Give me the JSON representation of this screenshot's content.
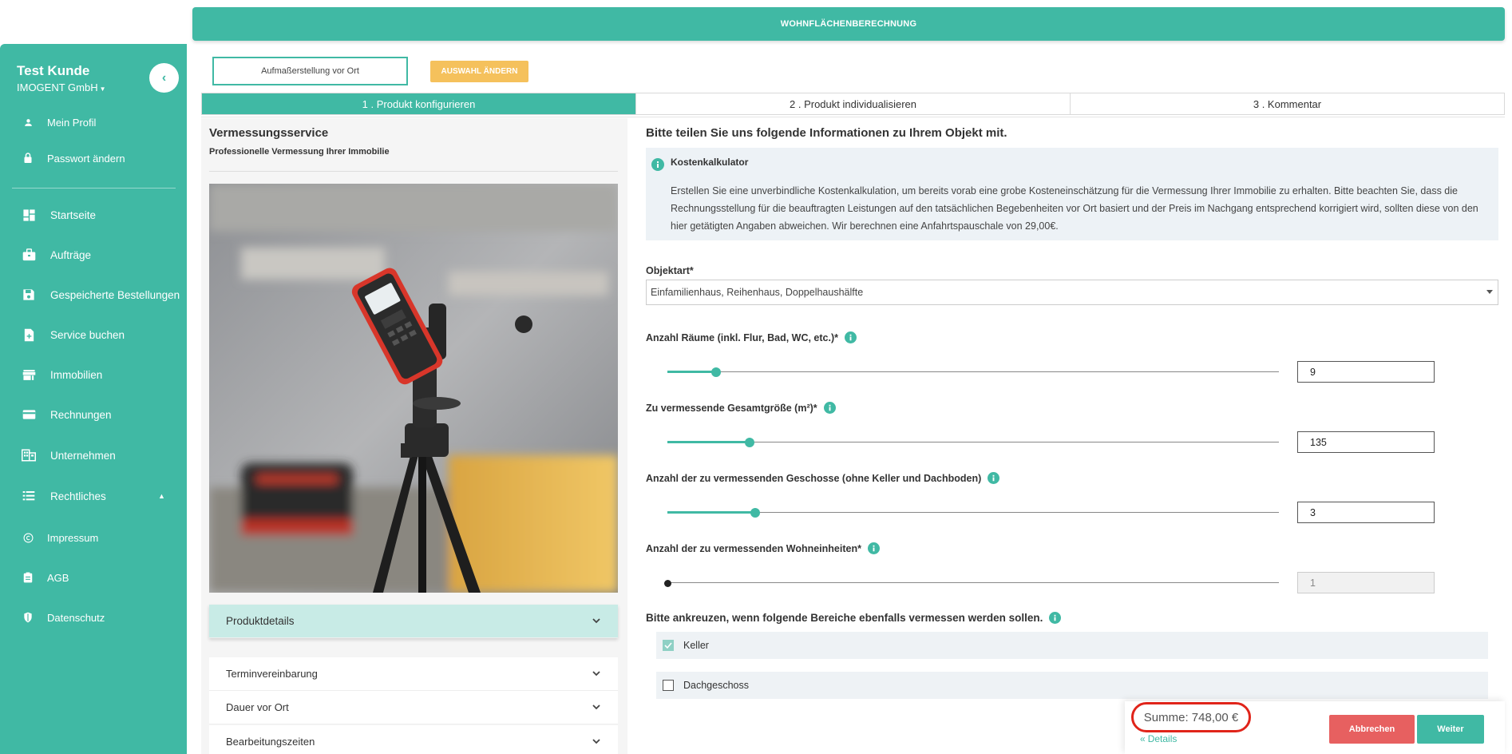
{
  "header": {
    "title": "WOHNFLÄCHENBERECHNUNG"
  },
  "sidebar": {
    "user_name": "Test Kunde",
    "company": "IMOGENT GmbH",
    "profile_items": [
      {
        "label": "Mein Profil",
        "icon": "person-icon"
      },
      {
        "label": "Passwort ändern",
        "icon": "lock-icon"
      }
    ],
    "nav_items": [
      {
        "label": "Startseite",
        "icon": "dashboard-icon"
      },
      {
        "label": "Aufträge",
        "icon": "briefcase-icon"
      },
      {
        "label": "Gespeicherte Bestellungen",
        "icon": "save-icon"
      },
      {
        "label": "Service buchen",
        "icon": "document-add-icon"
      },
      {
        "label": "Immobilien",
        "icon": "store-icon"
      },
      {
        "label": "Rechnungen",
        "icon": "credit-card-icon"
      },
      {
        "label": "Unternehmen",
        "icon": "company-icon"
      },
      {
        "label": "Rechtliches",
        "icon": "list-icon"
      }
    ],
    "legal_items": [
      {
        "label": "Impressum",
        "icon": "copyright-icon"
      },
      {
        "label": "AGB",
        "icon": "clipboard-icon"
      },
      {
        "label": "Datenschutz",
        "icon": "shield-icon"
      }
    ]
  },
  "toolbar": {
    "mode_label": "Aufmaßerstellung vor Ort",
    "change_label": "AUSWAHL ÄNDERN"
  },
  "steps": [
    {
      "label": "1 . Produkt konfigurieren",
      "active": true
    },
    {
      "label": "2 . Produkt individualisieren",
      "active": false
    },
    {
      "label": "3 . Kommentar",
      "active": false
    }
  ],
  "product": {
    "title": "Vermessungsservice",
    "subtitle": "Professionelle Vermessung Ihrer Immobilie",
    "accordion": [
      "Produktdetails",
      "Terminvereinbarung",
      "Dauer vor Ort",
      "Bearbeitungszeiten"
    ]
  },
  "form": {
    "heading": "Bitte teilen Sie uns folgende Informationen zu Ihrem Objekt mit.",
    "info_title": "Kostenkalkulator",
    "info_text": "Erstellen Sie eine unverbindliche Kostenkalkulation, um bereits vorab eine grobe Kosteneinschätzung für die Vermessung Ihrer Immobilie zu erhalten. Bitte beachten Sie, dass die Rechnungsstellung für die beauftragten Leistungen auf den tatsächlichen Begebenheiten vor Ort basiert und der Preis im Nachgang entsprechend korrigiert wird, sollten diese von den hier getätigten Angaben abweichen. Wir berechnen eine Anfahrtspauschale von 29,00€.",
    "objektart_label": "Objektart*",
    "objektart_value": "Einfamilienhaus, Reihenhaus, Doppelhaushälfte",
    "sliders": [
      {
        "label": "Anzahl Räume (inkl. Flur, Bad, WC, etc.)*",
        "value": "9",
        "level": 0.08,
        "disabled": false
      },
      {
        "label": "Zu vermessende Gesamtgröße (m²)*",
        "value": "135",
        "level": 0.135,
        "disabled": false
      },
      {
        "label": "Anzahl der zu vermessenden Geschosse (ohne Keller und Dachboden)",
        "value": "3",
        "level": 0.143,
        "disabled": false
      },
      {
        "label": "Anzahl der zu vermessenden Wohneinheiten*",
        "value": "1",
        "level": 0.0,
        "disabled": true
      }
    ],
    "checkbox_heading": "Bitte ankreuzen, wenn folgende Bereiche ebenfalls vermessen werden sollen.",
    "checkboxes": [
      {
        "label": "Keller",
        "checked": true
      },
      {
        "label": "Dachgeschoss",
        "checked": false
      }
    ]
  },
  "footer": {
    "sum": "Summe: 748,00 €",
    "details": "Details",
    "cancel": "Abbrechen",
    "next": "Weiter"
  },
  "colors": {
    "accent": "#40b9a4",
    "warning": "#f5c15c",
    "danger": "#e76060",
    "highlight": "#e0241a"
  }
}
